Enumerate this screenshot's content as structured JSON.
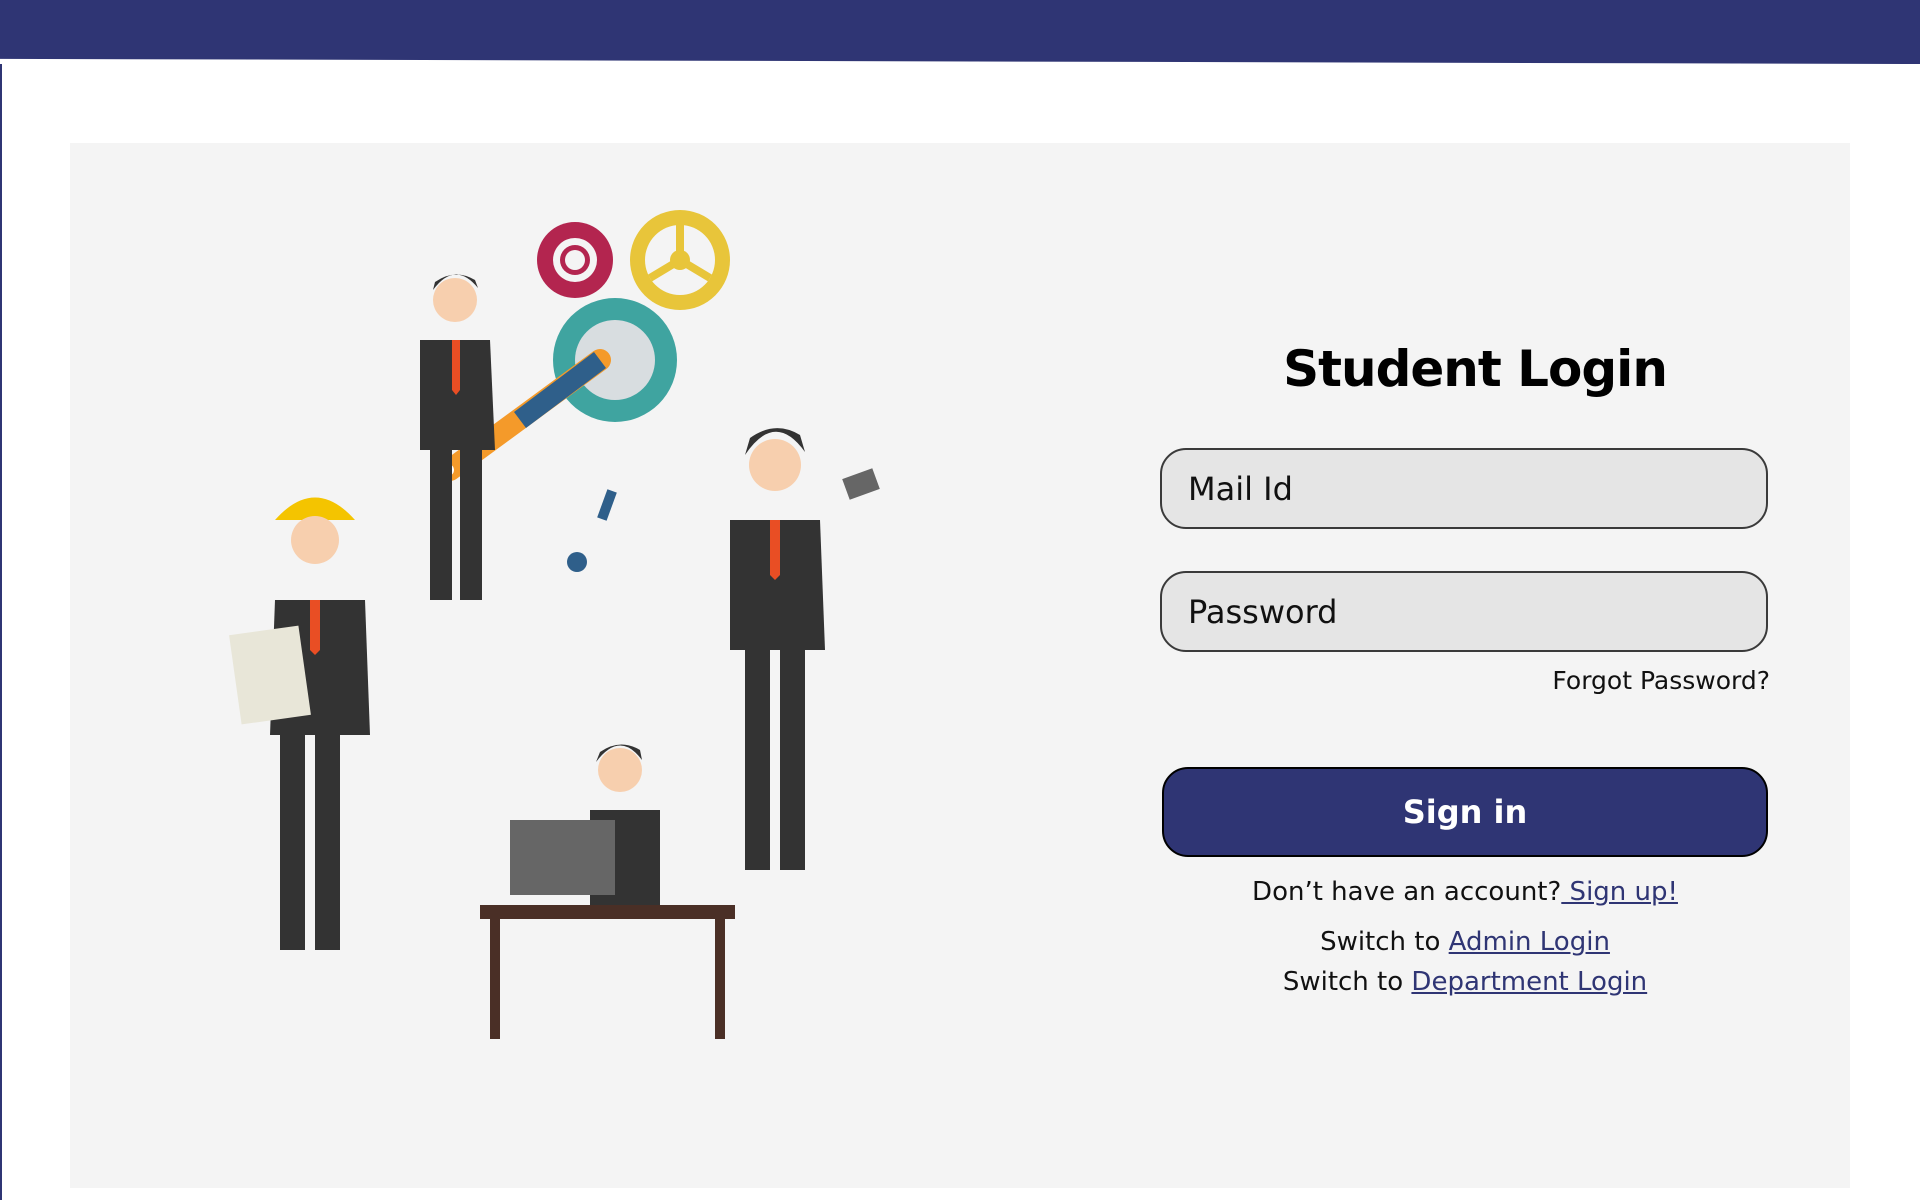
{
  "header": {
    "color": "#2f3574"
  },
  "illustration": {
    "icon": "office-workers-with-gears-illustration"
  },
  "login": {
    "title": "Student Login",
    "mail_placeholder": "Mail Id",
    "password_placeholder": "Password",
    "forgot_password": "Forgot Password?",
    "signin_label": "Sign in",
    "no_account_text": "Don’t have an account?",
    "signup_link": " Sign up!",
    "switch_text_1": "Switch to ",
    "admin_link": "Admin Login",
    "switch_text_2": "Switch to ",
    "department_link": "Department Login"
  },
  "colors": {
    "brand": "#2f3574",
    "panel_bg": "#f4f4f4",
    "field_bg": "#e5e5e5"
  }
}
